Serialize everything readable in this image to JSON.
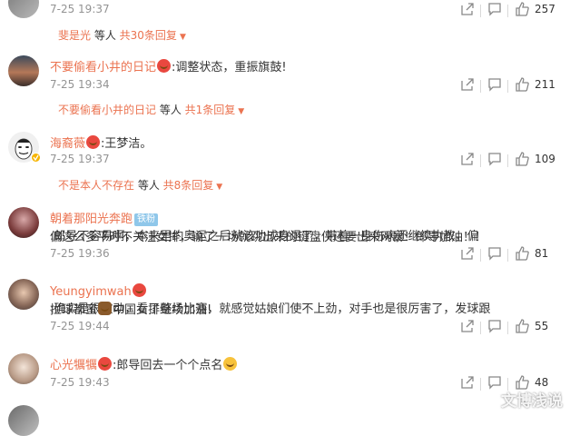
{
  "comments": [
    {
      "id": "c0",
      "time": "7-25 19:37",
      "likes": "257",
      "reply": {
        "who": "斐是光",
        "mid": " 等人 ",
        "count": "共30条回复"
      }
    },
    {
      "id": "c1",
      "name": "不要偷看小井的日记",
      "text": ":调整状态，重振旗鼓!",
      "time": "7-25 19:34",
      "likes": "211",
      "reply": {
        "who": "不要偷看小井的日记",
        "mid": " 等人 ",
        "count": "共1条回复"
      }
    },
    {
      "id": "c2",
      "name": "海裔薇",
      "text": ":王梦洁。",
      "time": "7-25 19:37",
      "likes": "109",
      "reply": {
        "who": "不是本人不存在",
        "mid": " 等人 ",
        "count": "共8条回复"
      }
    },
    {
      "id": "c3",
      "name": "朝着那阳光奔跑",
      "badge": "铁粉",
      "text_line1": ":郎导不容易啊，本来里约奥运之后就该功成身退了，带着一身伤病还继续执教，偏",
      "text_line2": "偏这么多平时不关注女排，输了一场就跳出来的键盘侠还要出来网暴！郎导加油！！",
      "time": "7-25 19:36",
      "likes": "81"
    },
    {
      "id": "c4",
      "name": "Yeungyimwah",
      "text_line1": ":确实是很被动，看了整场比赛，就感觉姑娘们使不上劲，对手也是很厉害了，发球跟",
      "text_line2a": "拦球都蛮",
      "text_line2b": "中国女排继续加油!",
      "time": "7-25 19:44",
      "likes": "55"
    },
    {
      "id": "c5",
      "name": "心光犡犡",
      "text": ":郎导回去一个个点名",
      "time": "7-25 19:43",
      "likes": "48"
    }
  ],
  "watermark": "文博浅说",
  "icons": {
    "share": "share-icon",
    "comment": "comment-icon",
    "like": "thumbs-up-icon",
    "caret": "caret-down-icon",
    "vip": "verified-badge-icon"
  },
  "colors": {
    "username": "#eb7350",
    "time": "#939393",
    "text": "#333333"
  }
}
